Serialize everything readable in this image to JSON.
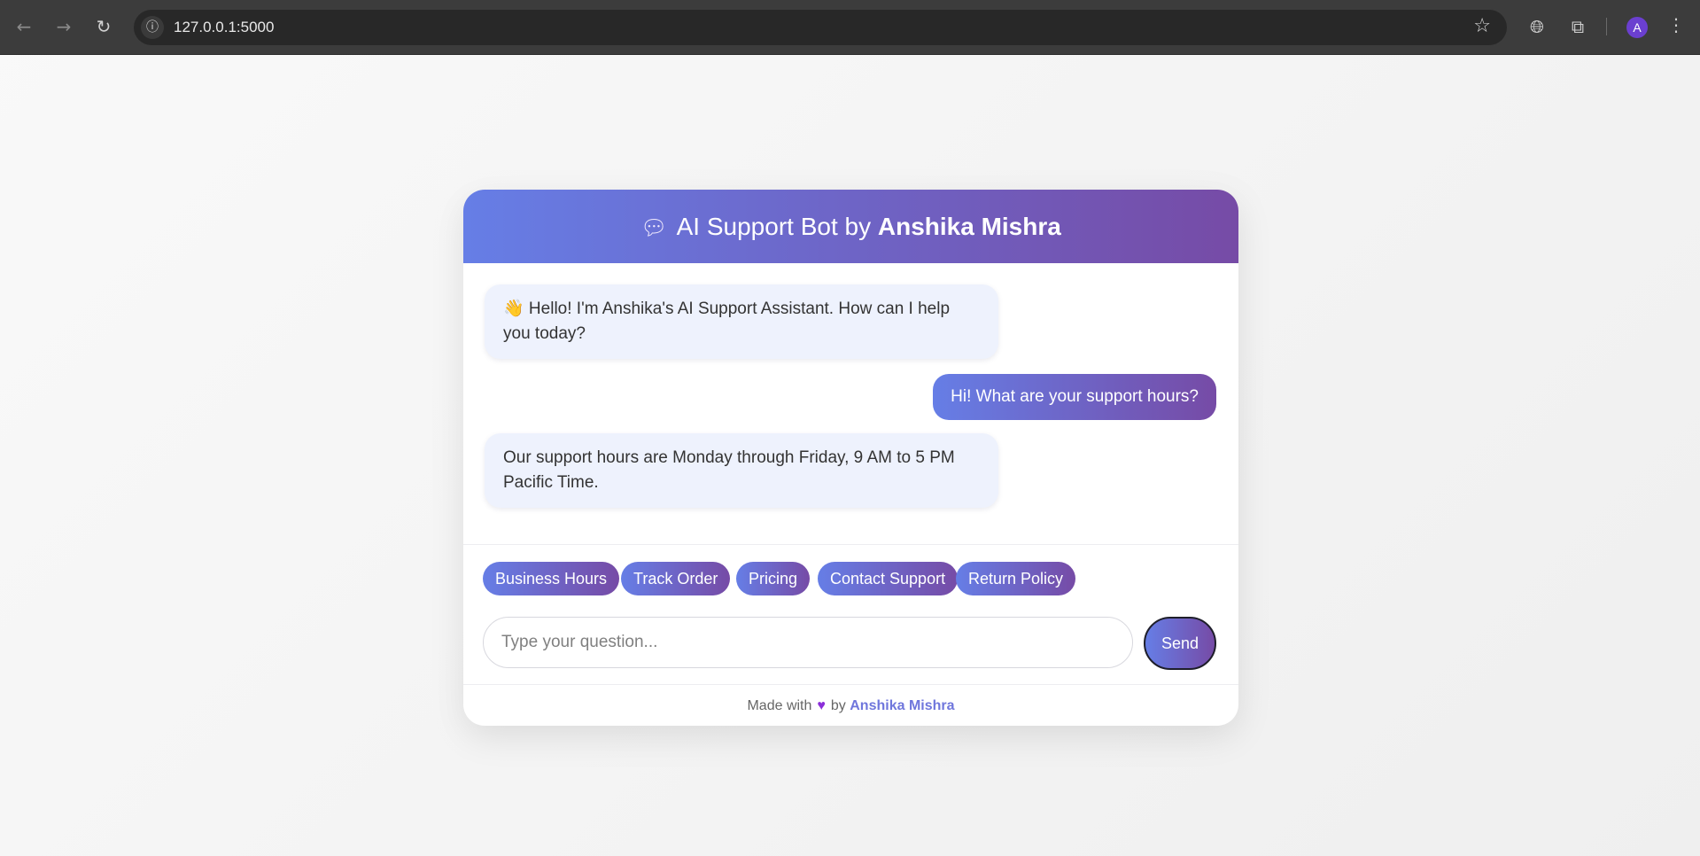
{
  "browser": {
    "url": "127.0.0.1:5000",
    "avatar_letter": "A"
  },
  "chat": {
    "header_prefix": "AI Support Bot by",
    "header_name": "Anshika Mishra",
    "messages": [
      {
        "role": "bot",
        "text": "👋 Hello! I'm Anshika's AI Support Assistant. How can I help you today?"
      },
      {
        "role": "user",
        "text": "Hi! What are your support hours?"
      },
      {
        "role": "bot",
        "text": "Our support hours are Monday through Friday, 9 AM to 5 PM Pacific Time."
      }
    ],
    "quick_replies": [
      "Business Hours",
      "Track Order",
      "Pricing",
      "Contact Support",
      "Return Policy"
    ],
    "input_placeholder": "Type your question...",
    "send_label": "Send"
  },
  "footer": {
    "made_with": "Made with",
    "by": "by",
    "author": "Anshika Mishra"
  },
  "colors": {
    "gradient_start": "#667ee6",
    "gradient_end": "#764ba6",
    "bot_bubble": "#eef2fd"
  }
}
